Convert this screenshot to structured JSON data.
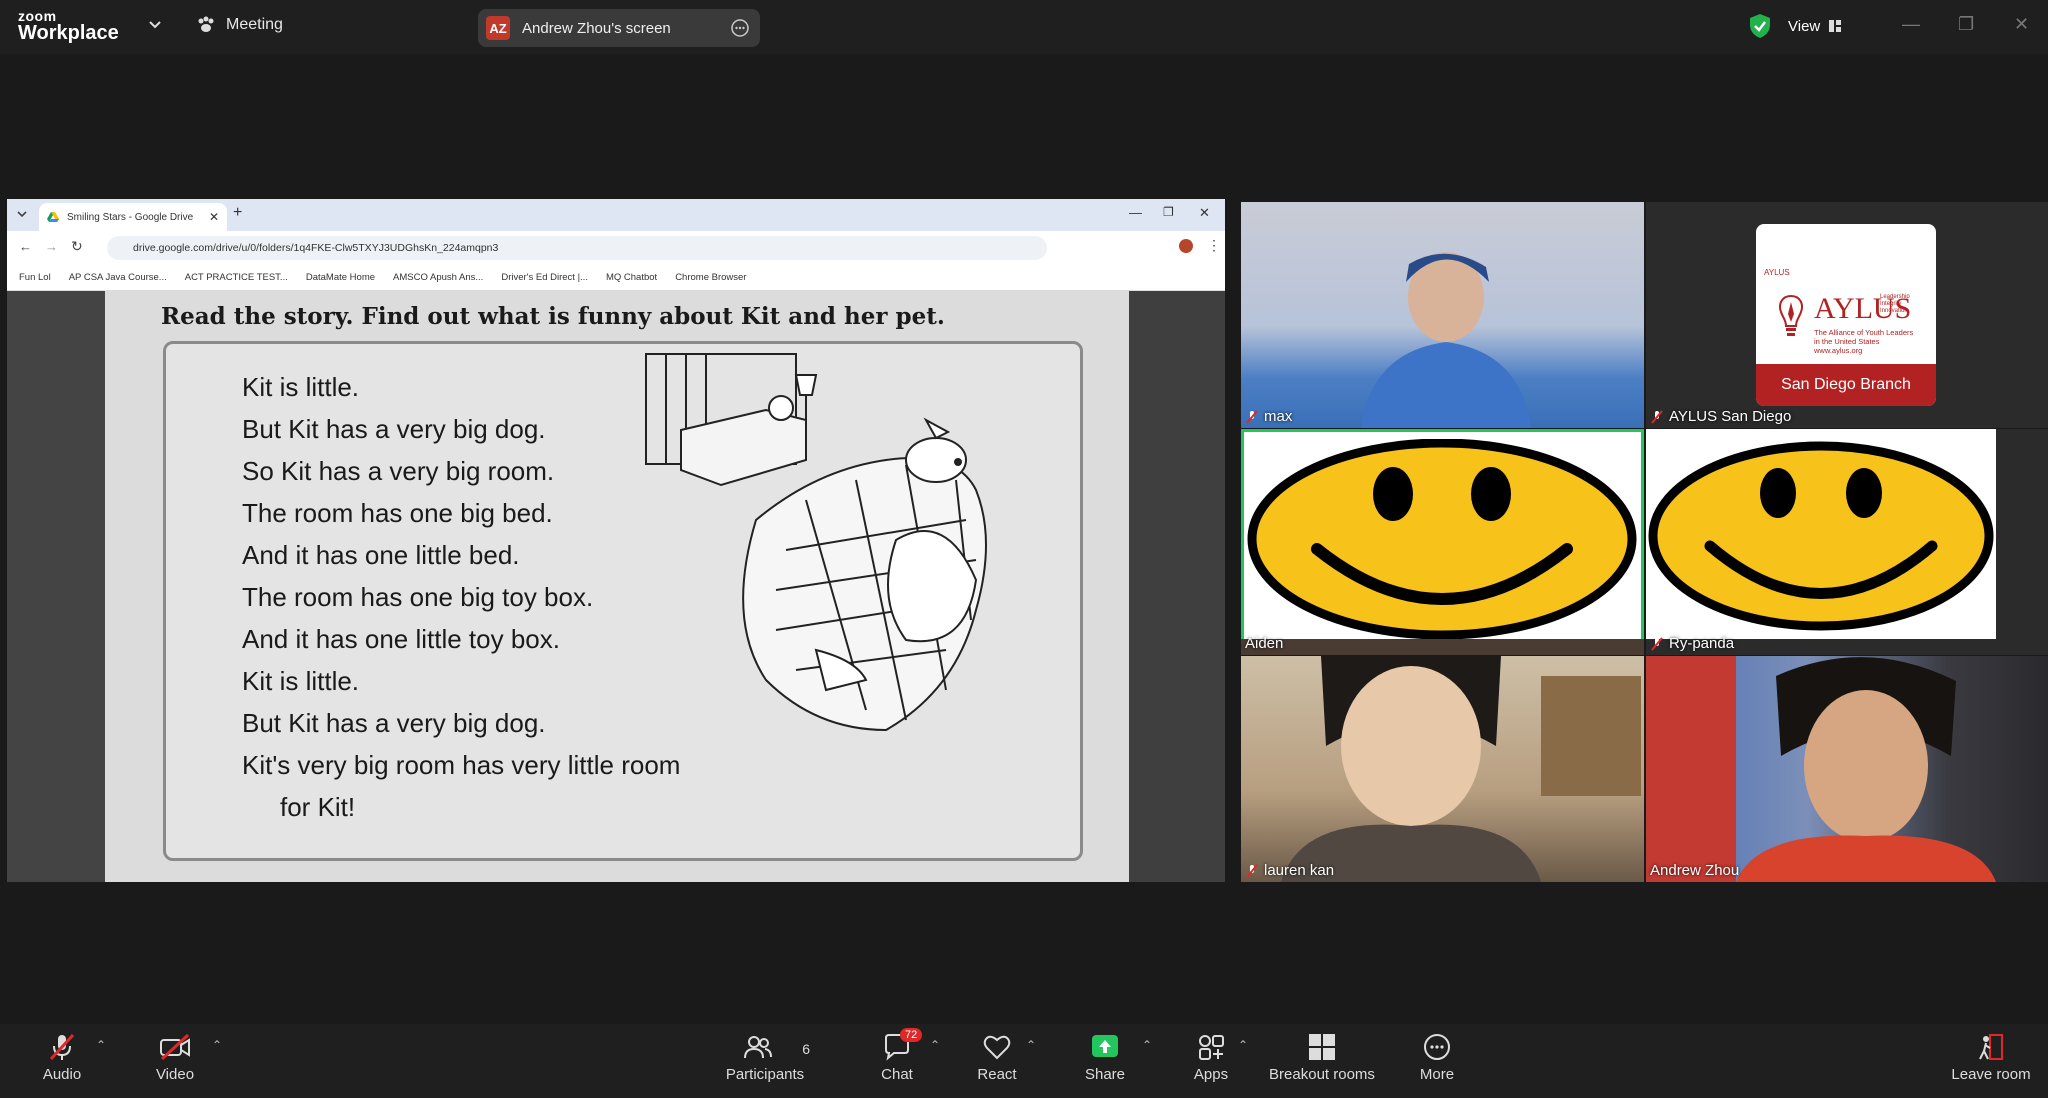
{
  "topbar": {
    "logo_small": "zoom",
    "logo_big": "Workplace",
    "meeting_label": "Meeting",
    "screen_badge": "AZ",
    "screen_label": "Andrew Zhou's screen",
    "view_label": "View",
    "colors": {
      "badge": "#c0392b",
      "shield": "#22b14c"
    }
  },
  "browser": {
    "tab_title": "Smiling Stars - Google Drive",
    "url": "drive.google.com/drive/u/0/folders/1q4FKE-Clw5TXYJ3UDGhsKn_224amqpn3",
    "bookmarks": [
      "Fun Lol",
      "AP CSA Java Course...",
      "ACT PRACTICE TEST...",
      "DataMate Home",
      "AMSCO Apush Ans...",
      "Driver's Ed Direct |...",
      "MQ Chatbot",
      "Chrome Browser"
    ]
  },
  "document": {
    "title": "Read the story. Find out what is funny about Kit and her pet.",
    "lines": [
      "Kit is little.",
      "But Kit has a very big dog.",
      "So Kit has a very big room.",
      "The room has one big bed.",
      "And it has one little bed.",
      "The room has one big toy box.",
      "And it has one little toy box.",
      "Kit is little.",
      "But Kit has a very big dog.",
      "Kit's very big room has very little room",
      "for Kit!"
    ]
  },
  "participants": [
    {
      "name": "max",
      "muted": true
    },
    {
      "name": "AYLUS San Diego",
      "muted": true
    },
    {
      "name": "Aiden",
      "muted": false,
      "active_speaker": true
    },
    {
      "name": "Ry-panda",
      "muted": true
    },
    {
      "name": "lauren kan",
      "muted": true
    },
    {
      "name": "Andrew Zhou",
      "muted": false
    }
  ],
  "aylus_card": {
    "brand": "AYLUS",
    "small_tag": "AYLUS",
    "tagline_1": "Leadership",
    "tagline_2": "Integrity",
    "tagline_3": "Innovation",
    "subtitle_1": "The Alliance of Youth Leaders",
    "subtitle_2": "in the United States",
    "site": "www.aylus.org",
    "branch": "San Diego Branch",
    "colors": {
      "brand": "#b22222"
    }
  },
  "toolbar": {
    "audio": "Audio",
    "video": "Video",
    "participants": "Participants",
    "participants_count": "6",
    "chat": "Chat",
    "chat_badge": "72",
    "react": "React",
    "share": "Share",
    "apps": "Apps",
    "breakout": "Breakout rooms",
    "more": "More",
    "leave": "Leave room",
    "colors": {
      "muted_red": "#e02828",
      "share_green": "#22c55e",
      "badge_red": "#e02828"
    }
  }
}
